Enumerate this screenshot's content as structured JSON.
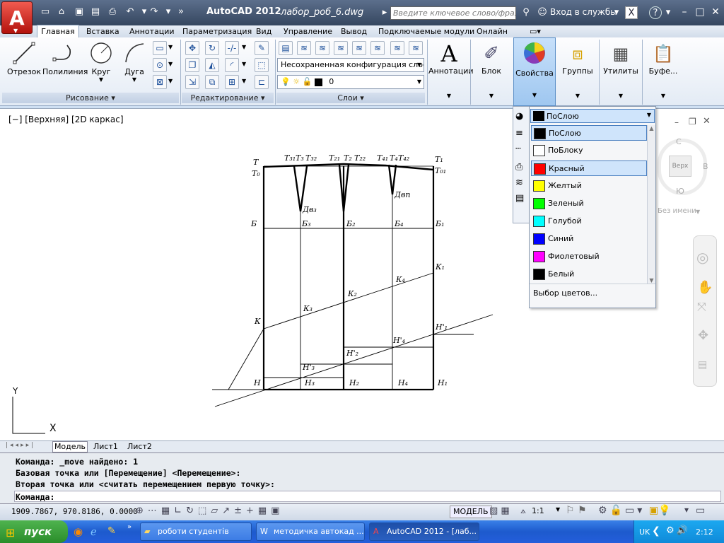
{
  "titlebar": {
    "app": "AutoCAD 2012",
    "file": "лабор_роб_6.dwg",
    "search_placeholder": "Введите ключевое слово/фразу",
    "signin": "Вход в службы"
  },
  "ribbon_tabs": [
    "Главная",
    "Вставка",
    "Аннотации",
    "Параметризация",
    "Вид",
    "Управление",
    "Вывод",
    "Подключаемые модули",
    "Онлайн"
  ],
  "draw_panel": {
    "title": "Рисование",
    "tools": [
      "Отрезок",
      "Полилиния",
      "Круг",
      "Дуга"
    ]
  },
  "modify_panel": {
    "title": "Редактирование"
  },
  "layers_panel": {
    "title": "Слои",
    "layer_state": "Несохраненная конфигурация слоев",
    "current_layer": "0"
  },
  "big_buttons": {
    "annotations": "Аннотации",
    "block": "Блок",
    "properties": "Свойства",
    "groups": "Группы",
    "utilities": "Утилиты",
    "clipboard": "Буфе..."
  },
  "drawing": {
    "view_label": "[−] [Верхняя] [2D каркас]",
    "labels": {
      "T": "Т",
      "T0": "Т₀",
      "T31": "Т₃₁",
      "T3": "Т₃",
      "T32": "Т₃₂",
      "T21": "Т₂₁",
      "T2": "Т₂",
      "T22": "Т₂₂",
      "T41": "Т₄₁",
      "T4": "Т₄",
      "T42": "Т₄₂",
      "T1": "Т₁",
      "T01": "Т₀₁",
      "B": "Б",
      "B3": "Б₃",
      "B2": "Б₂",
      "B4": "Б₄",
      "B1": "Б₁",
      "Dv3": "Дв₃",
      "Dvn": "Двп",
      "K": "К",
      "K3": "К₃",
      "K2": "К₂",
      "K4": "К₄",
      "K1": "К₁",
      "H": "Н",
      "H3": "Н₃",
      "H2": "Н₂",
      "H4": "Н₄",
      "H1": "Н₁",
      "H3p": "Н'₃",
      "H2p": "Н'₂",
      "H4p": "Н'₄",
      "H1p": "Н'₁"
    },
    "ucs_y": "Y",
    "ucs_x": "X"
  },
  "viewcube": {
    "north": "С",
    "south": "Ю",
    "east": "В",
    "face": "Верх",
    "named": "Без имени"
  },
  "color_dropdown": {
    "current": "ПоСлою",
    "items": [
      {
        "label": "ПоСлою",
        "color": "#000000"
      },
      {
        "label": "ПоБлоку",
        "color": "#ffffff"
      },
      {
        "label": "Красный",
        "color": "#ff0000"
      },
      {
        "label": "Желтый",
        "color": "#ffff00"
      },
      {
        "label": "Зеленый",
        "color": "#00ff00"
      },
      {
        "label": "Голубой",
        "color": "#00ffff"
      },
      {
        "label": "Синий",
        "color": "#0000ff"
      },
      {
        "label": "Фиолетовый",
        "color": "#ff00ff"
      },
      {
        "label": "Белый",
        "color": "#000000"
      }
    ],
    "more": "Выбор цветов..."
  },
  "layout_tabs": [
    "Модель",
    "Лист1",
    "Лист2"
  ],
  "command": {
    "lines": [
      "Команда: _move найдено: 1",
      "Базовая точка или [Перемещение] <Перемещение>:",
      "Вторая точка или <считать перемещением первую точку>:"
    ],
    "prompt": "Команда:"
  },
  "status": {
    "coords": "1909.7867, 970.8186, 0.0000",
    "model": "МОДЕЛЬ",
    "scale": "1:1"
  },
  "taskbar": {
    "start": "пуск",
    "tasks": [
      "роботи студентів",
      "методичка автокад ...",
      "AutoCAD 2012 - [лаб..."
    ],
    "lang": "UK",
    "time": "2:12"
  }
}
